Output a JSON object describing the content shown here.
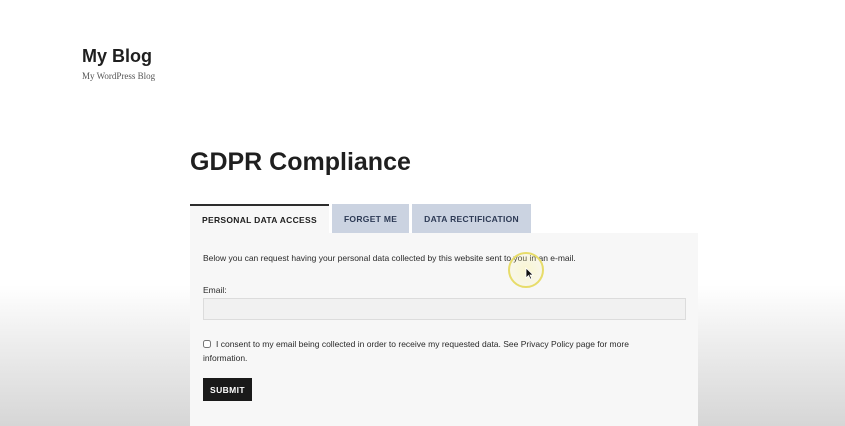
{
  "site": {
    "title": "My Blog",
    "tagline": "My WordPress Blog"
  },
  "page": {
    "title": "GDPR Compliance"
  },
  "tabs": [
    {
      "label": "PERSONAL DATA ACCESS",
      "active": true
    },
    {
      "label": "FORGET ME",
      "active": false
    },
    {
      "label": "DATA RECTIFICATION",
      "active": false
    }
  ],
  "form": {
    "intro": "Below you can request having your personal data collected by this website sent to you in an e-mail.",
    "email_label": "Email:",
    "email_value": "",
    "consent_checked": false,
    "consent_line1": "I consent to my email being collected in order to receive my requested data. See Privacy Policy page for more",
    "consent_line2": "information.",
    "submit_label": "SUBMIT"
  },
  "colors": {
    "tab_inactive_bg": "#cbd3e1",
    "panel_bg": "#f7f7f7",
    "button_bg": "#1a1a1a",
    "cursor_highlight": "#e7dc6a"
  },
  "icons": {
    "cursor": "mouse-pointer-icon"
  }
}
